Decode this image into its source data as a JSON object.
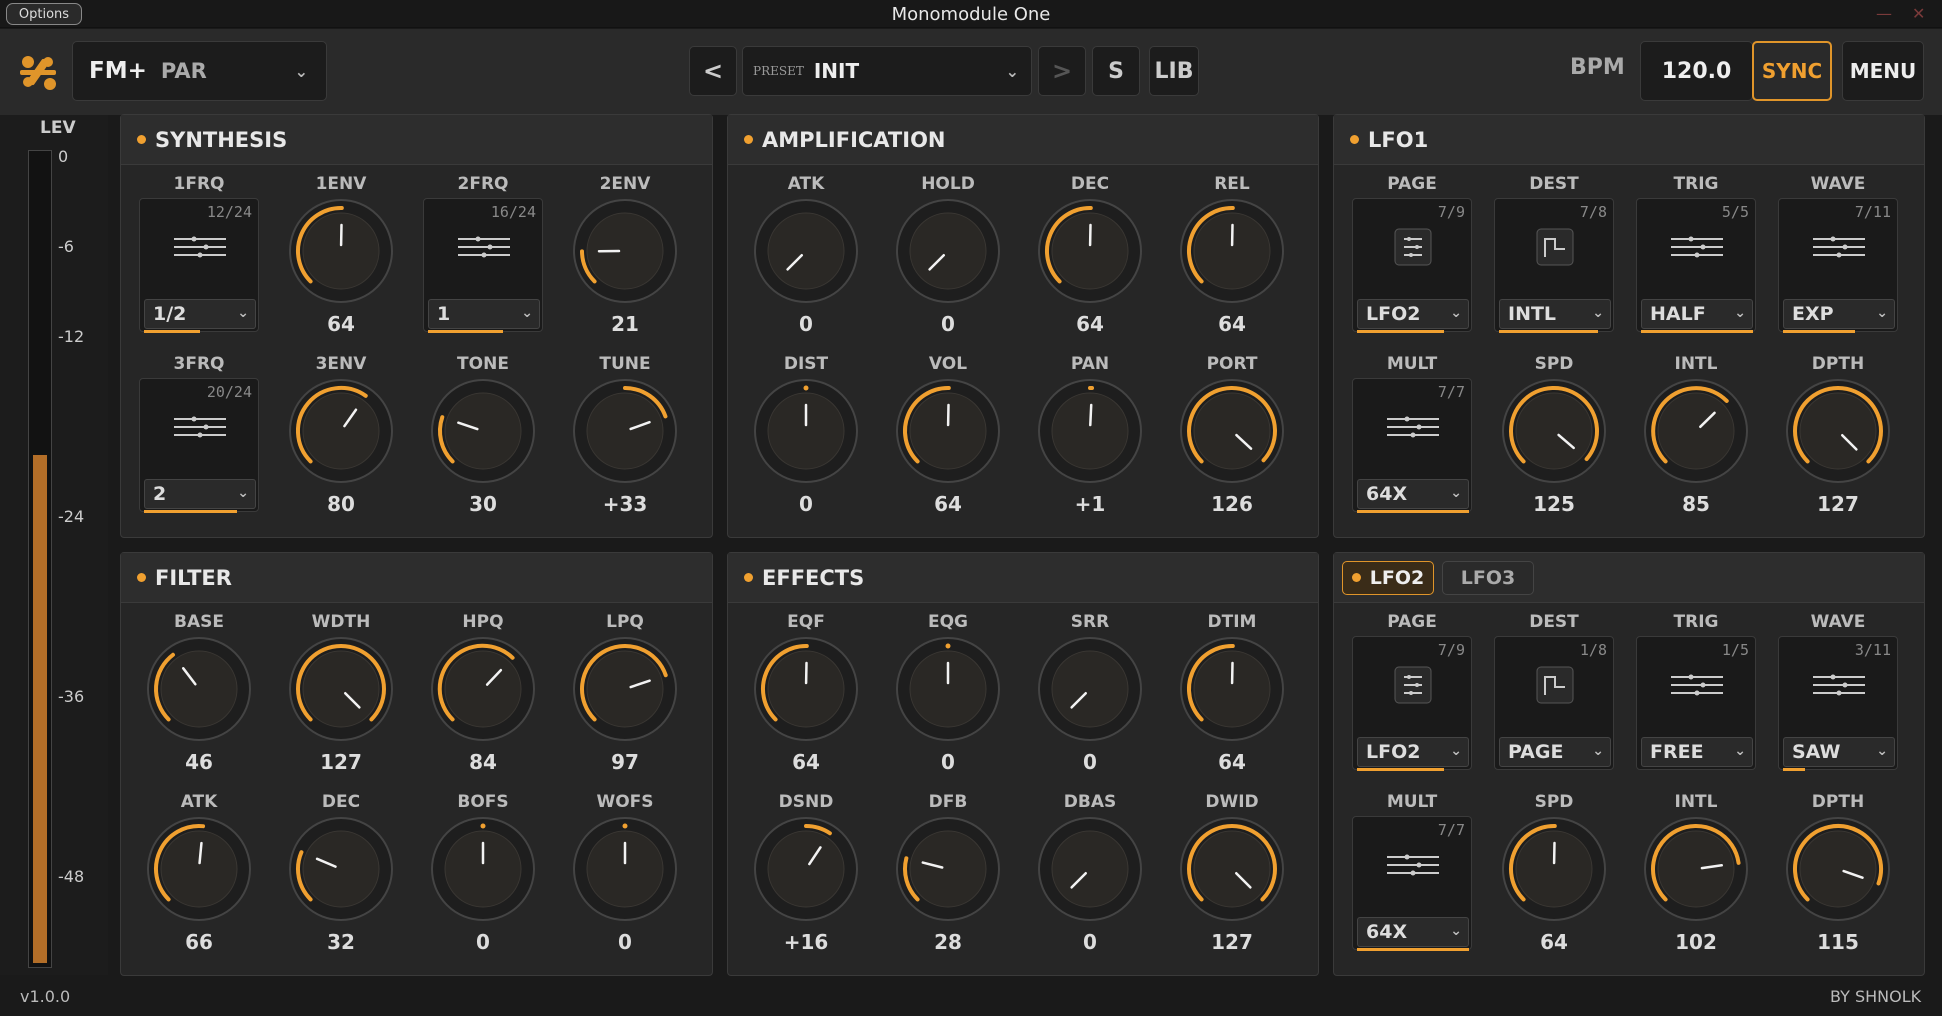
{
  "window": {
    "title": "Monomodule One",
    "options_label": "Options"
  },
  "header": {
    "mode_primary": "FM+",
    "mode_secondary": "PAR",
    "prev_label": "<",
    "next_label": ">",
    "preset_prefix": "PRESET",
    "preset_name": "INIT",
    "save_label": "S",
    "lib_label": "LIB",
    "bpm_label": "BPM",
    "bpm_value": "120.0",
    "sync_label": "SYNC",
    "menu_label": "MENU"
  },
  "level": {
    "label": "LEV",
    "ticks": [
      "0",
      "-6",
      "-12",
      "-24",
      "-36",
      "-48"
    ],
    "fill_fraction": 0.62
  },
  "sections": {
    "synthesis": "SYNTHESIS",
    "amplification": "AMPLIFICATION",
    "lfo1": "LFO1",
    "filter": "FILTER",
    "effects": "EFFECTS",
    "lfo_tabs": [
      "LFO2",
      "LFO3"
    ]
  },
  "synthesis": [
    {
      "label": "1FRQ",
      "type": "select",
      "counter": "12/24",
      "value": "1/2",
      "fill": 0.5
    },
    {
      "label": "1ENV",
      "type": "knob",
      "value": "64",
      "norm": 0.504
    },
    {
      "label": "2FRQ",
      "type": "select",
      "counter": "16/24",
      "value": "1",
      "fill": 0.67
    },
    {
      "label": "2ENV",
      "type": "knob",
      "value": "21",
      "norm": 0.165
    },
    {
      "label": "3FRQ",
      "type": "select",
      "counter": "20/24",
      "value": "2",
      "fill": 0.83
    },
    {
      "label": "3ENV",
      "type": "knob",
      "value": "80",
      "norm": 0.63
    },
    {
      "label": "TONE",
      "type": "knob",
      "value": "30",
      "norm": 0.236
    },
    {
      "label": "TUNE",
      "type": "knob",
      "value": "+33",
      "norm": 0.76,
      "bipolar": true
    }
  ],
  "amplification": [
    {
      "label": "ATK",
      "type": "knob",
      "value": "0",
      "norm": 0
    },
    {
      "label": "HOLD",
      "type": "knob",
      "value": "0",
      "norm": 0
    },
    {
      "label": "DEC",
      "type": "knob",
      "value": "64",
      "norm": 0.504
    },
    {
      "label": "REL",
      "type": "knob",
      "value": "64",
      "norm": 0.504
    },
    {
      "label": "DIST",
      "type": "knob",
      "value": "0",
      "norm": 0.5,
      "bipolar": true
    },
    {
      "label": "VOL",
      "type": "knob",
      "value": "64",
      "norm": 0.504
    },
    {
      "label": "PAN",
      "type": "knob",
      "value": "+1",
      "norm": 0.51,
      "bipolar": true
    },
    {
      "label": "PORT",
      "type": "knob",
      "value": "126",
      "norm": 0.992
    }
  ],
  "lfo1": [
    {
      "label": "PAGE",
      "type": "select",
      "counter": "7/9",
      "value": "LFO2",
      "fill": 0.78,
      "icon": "page"
    },
    {
      "label": "DEST",
      "type": "select",
      "counter": "7/8",
      "value": "INTL",
      "fill": 0.88,
      "icon": "dest"
    },
    {
      "label": "TRIG",
      "type": "select",
      "counter": "5/5",
      "value": "HALF",
      "fill": 1.0,
      "icon": "sliders"
    },
    {
      "label": "WAVE",
      "type": "select",
      "counter": "7/11",
      "value": "EXP",
      "fill": 0.64,
      "icon": "sliders"
    },
    {
      "label": "MULT",
      "type": "select",
      "counter": "7/7",
      "value": "64X",
      "fill": 1.0,
      "icon": "sliders"
    },
    {
      "label": "SPD",
      "type": "knob",
      "value": "125",
      "norm": 0.984
    },
    {
      "label": "INTL",
      "type": "knob",
      "value": "85",
      "norm": 0.669
    },
    {
      "label": "DPTH",
      "type": "knob",
      "value": "127",
      "norm": 1.0
    }
  ],
  "filter": [
    {
      "label": "BASE",
      "type": "knob",
      "value": "46",
      "norm": 0.362
    },
    {
      "label": "WDTH",
      "type": "knob",
      "value": "127",
      "norm": 1.0
    },
    {
      "label": "HPQ",
      "type": "knob",
      "value": "84",
      "norm": 0.661
    },
    {
      "label": "LPQ",
      "type": "knob",
      "value": "97",
      "norm": 0.764
    },
    {
      "label": "ATK",
      "type": "knob",
      "value": "66",
      "norm": 0.52
    },
    {
      "label": "DEC",
      "type": "knob",
      "value": "32",
      "norm": 0.252
    },
    {
      "label": "BOFS",
      "type": "knob",
      "value": "0",
      "norm": 0.5,
      "bipolar": true
    },
    {
      "label": "WOFS",
      "type": "knob",
      "value": "0",
      "norm": 0.5,
      "bipolar": true
    }
  ],
  "effects": [
    {
      "label": "EQF",
      "type": "knob",
      "value": "64",
      "norm": 0.504
    },
    {
      "label": "EQG",
      "type": "knob",
      "value": "0",
      "norm": 0.5,
      "bipolar": true
    },
    {
      "label": "SRR",
      "type": "knob",
      "value": "0",
      "norm": 0
    },
    {
      "label": "DTIM",
      "type": "knob",
      "value": "64",
      "norm": 0.504
    },
    {
      "label": "DSND",
      "type": "knob",
      "value": "+16",
      "norm": 0.625,
      "bipolar": true
    },
    {
      "label": "DFB",
      "type": "knob",
      "value": "28",
      "norm": 0.22
    },
    {
      "label": "DBAS",
      "type": "knob",
      "value": "0",
      "norm": 0
    },
    {
      "label": "DWID",
      "type": "knob",
      "value": "127",
      "norm": 1.0
    }
  ],
  "lfo2": [
    {
      "label": "PAGE",
      "type": "select",
      "counter": "7/9",
      "value": "LFO2",
      "fill": 0.78,
      "icon": "page"
    },
    {
      "label": "DEST",
      "type": "select",
      "counter": "1/8",
      "value": "PAGE",
      "fill": 0.0,
      "icon": "dest"
    },
    {
      "label": "TRIG",
      "type": "select",
      "counter": "1/5",
      "value": "FREE",
      "fill": 0.0,
      "icon": "sliders"
    },
    {
      "label": "WAVE",
      "type": "select",
      "counter": "3/11",
      "value": "SAW",
      "fill": 0.2,
      "icon": "sliders"
    },
    {
      "label": "MULT",
      "type": "select",
      "counter": "7/7",
      "value": "64X",
      "fill": 1.0,
      "icon": "sliders"
    },
    {
      "label": "SPD",
      "type": "knob",
      "value": "64",
      "norm": 0.504
    },
    {
      "label": "INTL",
      "type": "knob",
      "value": "102",
      "norm": 0.803
    },
    {
      "label": "DPTH",
      "type": "knob",
      "value": "115",
      "norm": 0.906
    }
  ],
  "footer": {
    "version": "v1.0.0",
    "credit": "BY SHNOLK"
  },
  "colors": {
    "accent": "#f0a030",
    "panel": "#262626",
    "background": "#1a1a1a"
  }
}
